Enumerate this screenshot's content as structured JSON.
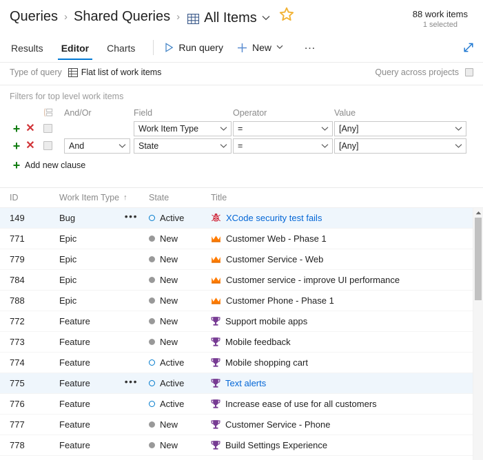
{
  "breadcrumb": {
    "root": "Queries",
    "folder": "Shared Queries",
    "query": "All Items",
    "separator": "›",
    "chevron": "⌄",
    "grid_icon": "query-grid-icon",
    "star_icon": "favorite-star-icon"
  },
  "header": {
    "count": "88 work items",
    "selected": "1 selected"
  },
  "tabs": [
    {
      "label": "Results",
      "active": false
    },
    {
      "label": "Editor",
      "active": true
    },
    {
      "label": "Charts",
      "active": false
    }
  ],
  "toolbar": {
    "run_query": "Run query",
    "run_icon": "play-triangle-icon",
    "new": "New",
    "new_icon": "plus-icon",
    "new_chevron": "⌄",
    "more": "…",
    "more_icon": "ellipsis-icon",
    "expand_icon": "expand-diagonal-icon"
  },
  "query_type": {
    "label": "Type of query",
    "value": "Flat list of work items",
    "icon": "flat-list-grid-icon",
    "across_label": "Query across projects",
    "across_checked": false
  },
  "filters": {
    "title": "Filters for top level work items",
    "columns": {
      "group": "grouping-icon",
      "andor": "And/Or",
      "field": "Field",
      "operator": "Operator",
      "value": "Value"
    },
    "add_icon": "+",
    "remove_icon": "✕",
    "caret": "⌄",
    "rows": [
      {
        "andor": "",
        "field": "Work Item Type",
        "operator": "=",
        "value": "[Any]",
        "checked": false
      },
      {
        "andor": "And",
        "field": "State",
        "operator": "=",
        "value": "[Any]",
        "checked": false
      }
    ],
    "add_clause": "Add new clause"
  },
  "grid": {
    "columns": [
      {
        "key": "id",
        "label": "ID",
        "sorted": false
      },
      {
        "key": "type",
        "label": "Work Item Type",
        "sorted": true,
        "sort_arrow": "↑"
      },
      {
        "key": "state",
        "label": "State",
        "sorted": false
      },
      {
        "key": "title",
        "label": "Title",
        "sorted": false
      }
    ],
    "rows": [
      {
        "id": "149",
        "type": "Bug",
        "state": "Active",
        "title": "XCode security test fails",
        "icon": "bug-ladybug-icon",
        "selected": true,
        "show_menu": true,
        "title_link": true
      },
      {
        "id": "771",
        "type": "Epic",
        "state": "New",
        "title": "Customer Web - Phase 1",
        "icon": "epic-crown-icon",
        "selected": false,
        "show_menu": false,
        "title_link": false
      },
      {
        "id": "779",
        "type": "Epic",
        "state": "New",
        "title": "Customer Service - Web",
        "icon": "epic-crown-icon",
        "selected": false,
        "show_menu": false,
        "title_link": false
      },
      {
        "id": "784",
        "type": "Epic",
        "state": "New",
        "title": "Customer service - improve UI performance",
        "icon": "epic-crown-icon",
        "selected": false,
        "show_menu": false,
        "title_link": false
      },
      {
        "id": "788",
        "type": "Epic",
        "state": "New",
        "title": "Customer Phone - Phase 1",
        "icon": "epic-crown-icon",
        "selected": false,
        "show_menu": false,
        "title_link": false
      },
      {
        "id": "772",
        "type": "Feature",
        "state": "New",
        "title": "Support mobile apps",
        "icon": "feature-trophy-icon",
        "selected": false,
        "show_menu": false,
        "title_link": false
      },
      {
        "id": "773",
        "type": "Feature",
        "state": "New",
        "title": "Mobile feedback",
        "icon": "feature-trophy-icon",
        "selected": false,
        "show_menu": false,
        "title_link": false
      },
      {
        "id": "774",
        "type": "Feature",
        "state": "Active",
        "title": "Mobile shopping cart",
        "icon": "feature-trophy-icon",
        "selected": false,
        "show_menu": false,
        "title_link": false
      },
      {
        "id": "775",
        "type": "Feature",
        "state": "Active",
        "title": "Text alerts",
        "icon": "feature-trophy-icon",
        "selected": true,
        "show_menu": true,
        "title_link": true
      },
      {
        "id": "776",
        "type": "Feature",
        "state": "Active",
        "title": "Increase ease of use for all customers",
        "icon": "feature-trophy-icon",
        "selected": false,
        "show_menu": false,
        "title_link": false
      },
      {
        "id": "777",
        "type": "Feature",
        "state": "New",
        "title": "Customer Service - Phone",
        "icon": "feature-trophy-icon",
        "selected": false,
        "show_menu": false,
        "title_link": false
      },
      {
        "id": "778",
        "type": "Feature",
        "state": "New",
        "title": "Build Settings Experience",
        "icon": "feature-trophy-icon",
        "selected": false,
        "show_menu": false,
        "title_link": false
      }
    ],
    "row_menu_icon": "•••"
  },
  "colors": {
    "accent": "#0078d4",
    "link": "#0366d6",
    "bug": "#cc293d",
    "epic": "#ff7b00",
    "feature": "#773b93",
    "state_active": "#007acc",
    "state_new": "#999999",
    "add_green": "#107c10",
    "remove_red": "#d13438",
    "star": "#f2b233",
    "selected_row": "#eff6fc"
  }
}
